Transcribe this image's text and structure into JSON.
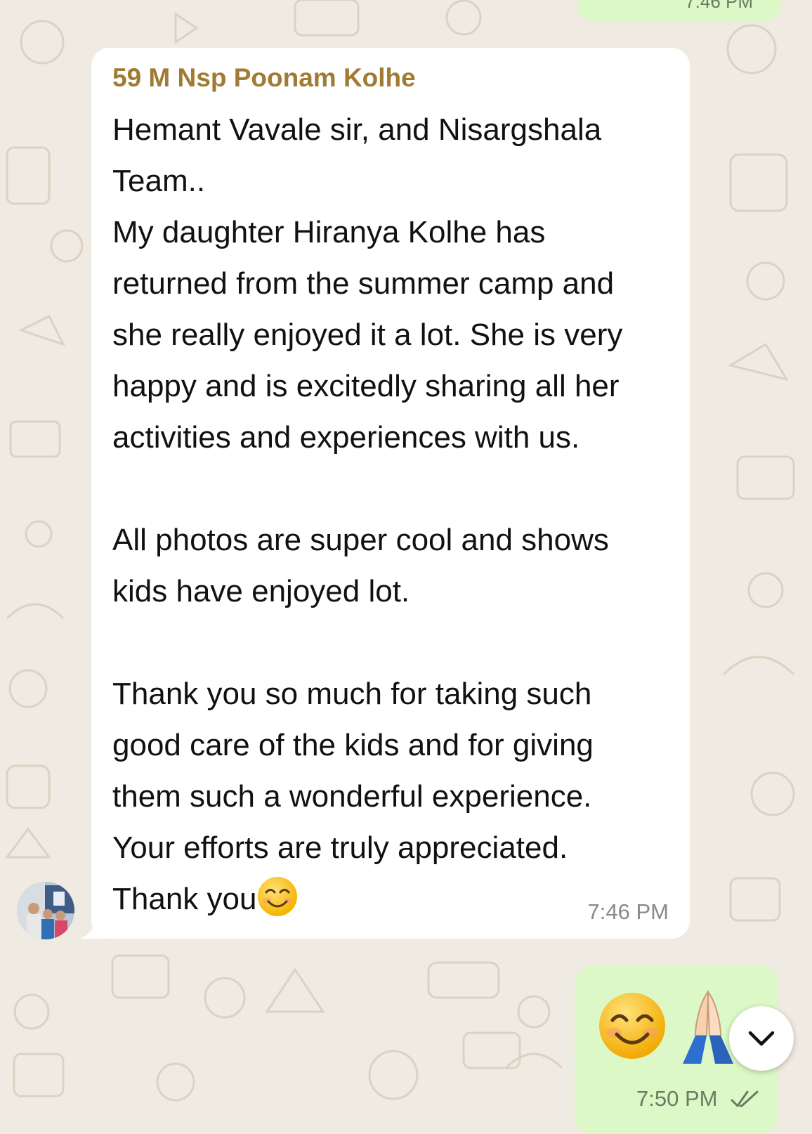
{
  "colors": {
    "chat_background": "#efeae2",
    "incoming_bubble": "#ffffff",
    "outgoing_bubble": "#dcf8c6",
    "sender_name": "#a17a33"
  },
  "messages": {
    "incoming": {
      "sender": "59 M Nsp Poonam Kolhe",
      "text": "Hemant Vavale sir, and Nisargshala\nTeam..\nMy daughter Hiranya Kolhe has\nreturned from the summer camp and\nshe really enjoyed it a lot. She is very\nhappy and is excitedly sharing all her\nactivities and experiences with us.\n\nAll photos are super cool and shows\nkids have enjoyed lot.\n\nThank you so much for taking such\ngood care of the kids and for giving\nthem such a wonderful experience.\nYour efforts are truly appreciated.\nThank you",
      "trailing_emoji": "smiling-face-icon",
      "time": "7:46 PM"
    },
    "outgoing": {
      "emojis": [
        "smiling-face-icon",
        "folded-hands-icon"
      ],
      "time": "7:50 PM",
      "status": "read-double-check-icon"
    },
    "previous_outgoing": {
      "time": "7:46 PM"
    }
  },
  "controls": {
    "scroll_down_icon": "chevron-down-icon"
  }
}
